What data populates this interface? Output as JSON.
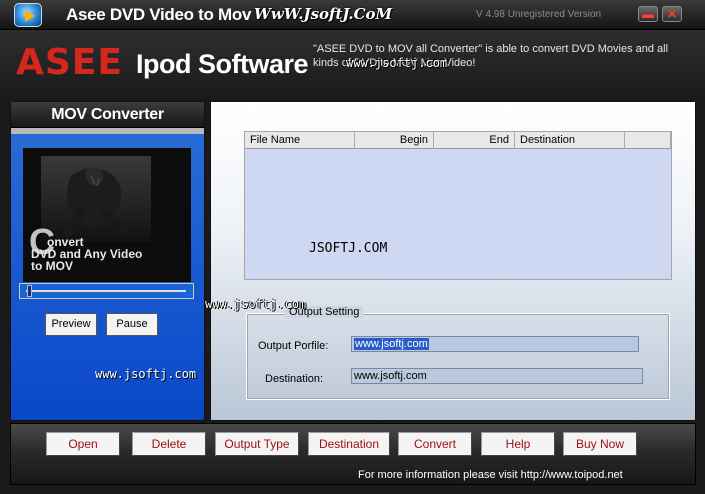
{
  "window": {
    "title": "Asee DVD Video to Mov",
    "title_watermark": "WwW.JsoftJ.CoM",
    "version": "V 4.98 Unregistered Version",
    "minimize_glyph": "▬",
    "close_glyph": "✕"
  },
  "brand": {
    "logo_main": "ASEE",
    "logo_sub": "Ipod Software",
    "description": "\"ASEE DVD to MOV all Converter\" is able to convert DVD Movies and all kinds of DVD to MOV Mac Video!",
    "watermark": "www.jsoftj.com"
  },
  "left_panel": {
    "header": "MOV Converter",
    "video_text_letter": "C",
    "video_text_line1": "onvert",
    "video_text_line2": "DVD and Any Video",
    "video_text_line3": "to MOV",
    "seek_position": 0.02,
    "preview_label": "Preview",
    "pause_label": "Pause",
    "watermark": "www.jsoftj.com"
  },
  "middle_watermark": "www.jsoftj.com",
  "file_list": {
    "columns": [
      "File Name",
      "Begin",
      "End",
      "Destination",
      ""
    ],
    "watermark": "JSOFTJ.COM"
  },
  "output_setting": {
    "legend": "Output Setting",
    "profile_label": "Output Porfile:",
    "profile_value": "www.jsoftj.com",
    "destination_label": "Destination:",
    "destination_value": "www.jsoftj.com"
  },
  "toolbar": {
    "open": "Open",
    "delete": "Delete",
    "output_type": "Output Type",
    "destination": "Destination",
    "convert": "Convert",
    "help": "Help",
    "buy_now": "Buy Now"
  },
  "footer": {
    "info": "For more information please visit http://www.toipod.net"
  }
}
